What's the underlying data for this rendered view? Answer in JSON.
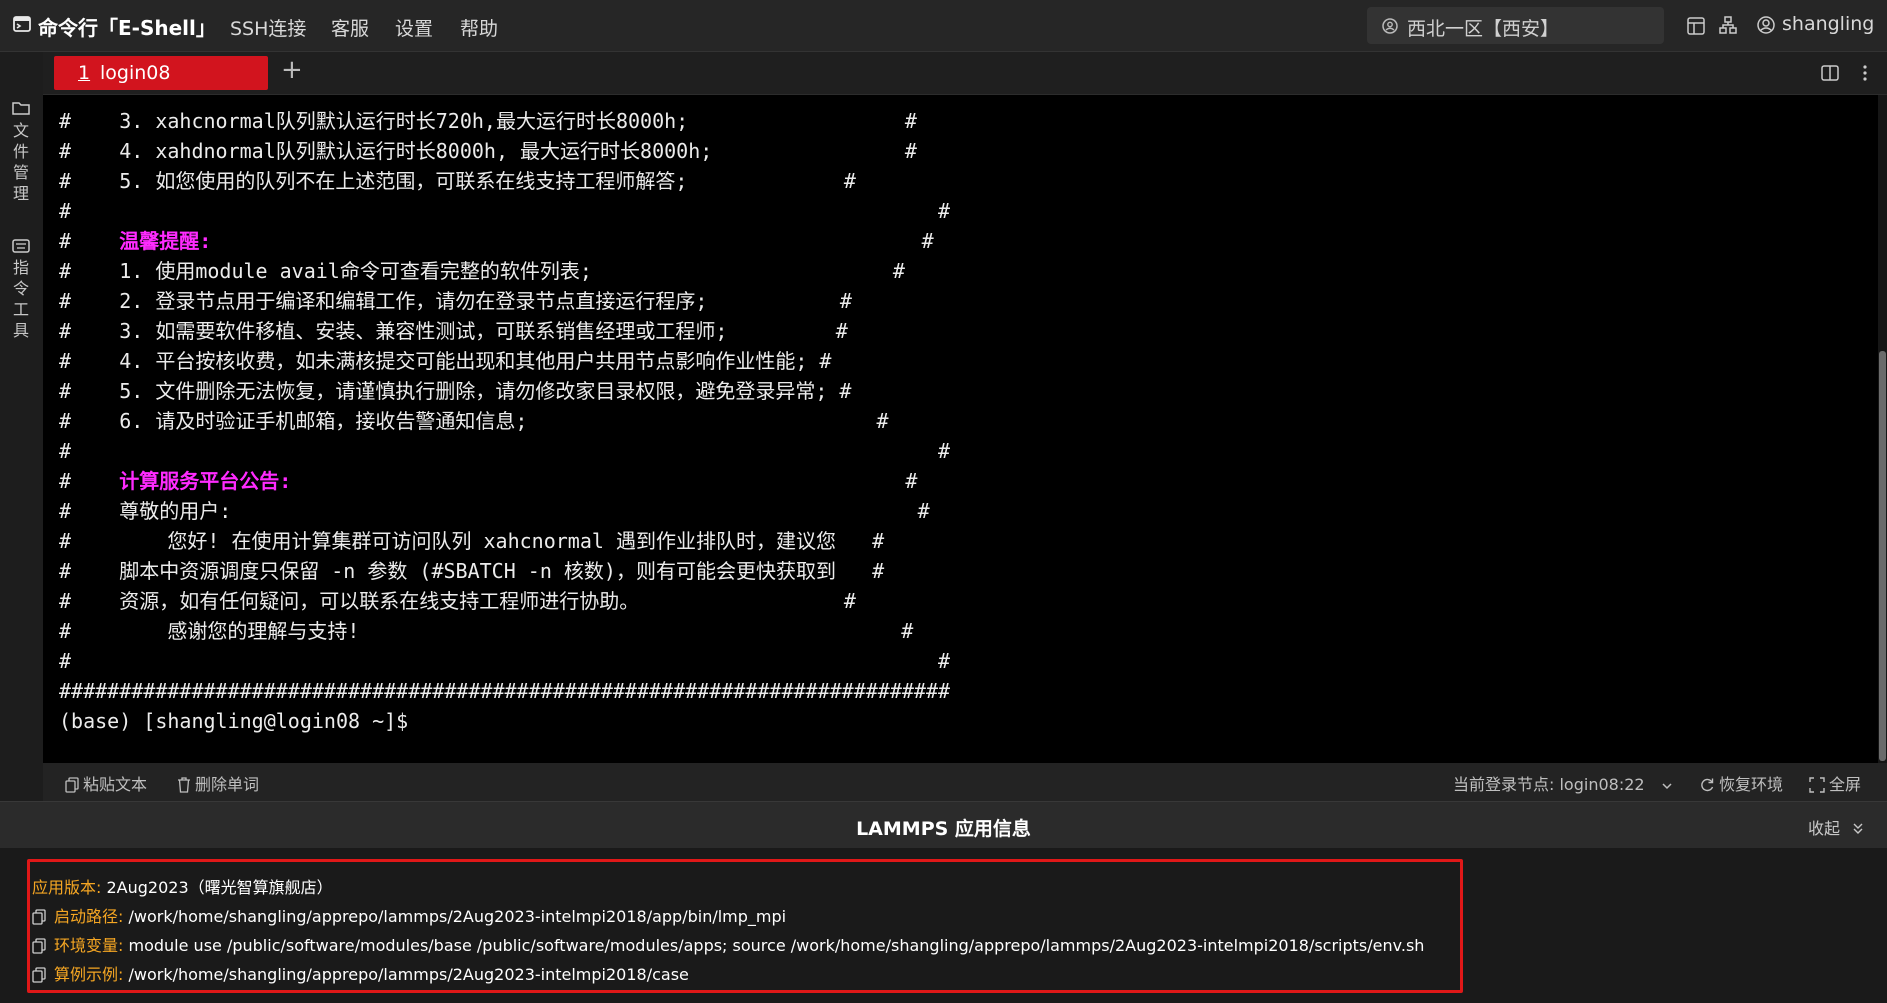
{
  "app": {
    "title": "命令行「E-Shell」",
    "menu": [
      "SSH连接",
      "客服",
      "设置",
      "帮助"
    ],
    "region": "西北一区【西安】",
    "user": "shangling",
    "icons": [
      "terminal-logo-icon",
      "region-icon",
      "layout-icon",
      "sitemap-icon",
      "user-icon"
    ]
  },
  "sidebar": {
    "items": [
      {
        "label": "文件管理",
        "icon": "folder-icon"
      },
      {
        "label": "指令工具",
        "icon": "keyboard-icon"
      }
    ]
  },
  "tabs": [
    {
      "number": "1",
      "label": "login08",
      "active": true
    }
  ],
  "tab_add": "+",
  "terminal": {
    "lines": [
      [
        {
          "t": "#    3. xahcnormal队列默认运行时长720h,最大运行时长8000h;                  #"
        }
      ],
      [
        {
          "t": "#    4. xahdnormal队列默认运行时长8000h, 最大运行时长8000h;                #"
        }
      ],
      [
        {
          "t": "#    5. 如您使用的队列不在上述范围，可联系在线支持工程师解答;             #"
        }
      ],
      [
        {
          "t": "#                                                                        #"
        }
      ],
      [
        {
          "t": "#    "
        },
        {
          "t": "温馨提醒:",
          "c": "pink"
        },
        {
          "t": "                                                           #"
        }
      ],
      [
        {
          "t": "#    1. 使用module avail命令可查看完整的软件列表;                         #"
        }
      ],
      [
        {
          "t": "#    2. 登录节点用于编译和编辑工作，请勿在登录节点直接运行程序;           #"
        }
      ],
      [
        {
          "t": "#    3. 如需要软件移植、安装、兼容性测试，可联系销售经理或工程师;         #"
        }
      ],
      [
        {
          "t": "#    4. 平台按核收费，如未满核提交可能出现和其他用户共用节点影响作业性能; #"
        }
      ],
      [
        {
          "t": "#    5. 文件删除无法恢复，请谨慎执行删除，请勿修改家目录权限，避免登录异常; #"
        }
      ],
      [
        {
          "t": "#    6. 请及时验证手机邮箱，接收告警通知信息;                             #"
        }
      ],
      [
        {
          "t": "#                                                                        #"
        }
      ],
      [
        {
          "t": "#    "
        },
        {
          "t": "计算服务平台公告:",
          "c": "pink"
        },
        {
          "t": "                                                   #"
        }
      ],
      [
        {
          "t": "#    尊敬的用户:                                                         #"
        }
      ],
      [
        {
          "t": "#        您好! 在使用计算集群可访问队列 xahcnormal 遇到作业排队时，建议您   #"
        }
      ],
      [
        {
          "t": "#    脚本中资源调度只保留 -n 参数 (#SBATCH -n 核数)，则有可能会更快获取到   #"
        }
      ],
      [
        {
          "t": "#    资源，如有任何疑问，可以联系在线支持工程师进行协助。                 #"
        }
      ],
      [
        {
          "t": "#        感谢您的理解与支持!                                             #"
        }
      ],
      [
        {
          "t": "#                                                                        #"
        }
      ],
      [
        {
          "t": "##########################################################################"
        }
      ],
      [
        {
          "t": "(base) [shangling@login08 ~]$"
        }
      ]
    ]
  },
  "toolbar": {
    "paste": "粘贴文本",
    "delete_word": "删除单词",
    "node_label": "当前登录节点: login08:22",
    "restore": "恢复环境",
    "fullscreen": "全屏"
  },
  "panel": {
    "title": "LAMMPS 应用信息",
    "collapse": "收起",
    "rows": [
      {
        "label": "应用版本:",
        "value": "2Aug2023（曙光智算旗舰店）",
        "copy": false
      },
      {
        "label": "启动路径:",
        "value": "/work/home/shangling/apprepo/lammps/2Aug2023-intelmpi2018/app/bin/lmp_mpi",
        "copy": true
      },
      {
        "label": "环境变量:",
        "value": "module use /public/software/modules/base /public/software/modules/apps; source /work/home/shangling/apprepo/lammps/2Aug2023-intelmpi2018/scripts/env.sh",
        "copy": true
      },
      {
        "label": "算例示例:",
        "value": "/work/home/shangling/apprepo/lammps/2Aug2023-intelmpi2018/case",
        "copy": true
      }
    ]
  },
  "colors": {
    "accent": "#d2141e",
    "highlight": "#ff2bff",
    "label": "#f5a623",
    "terminal_bg": "#000000"
  }
}
